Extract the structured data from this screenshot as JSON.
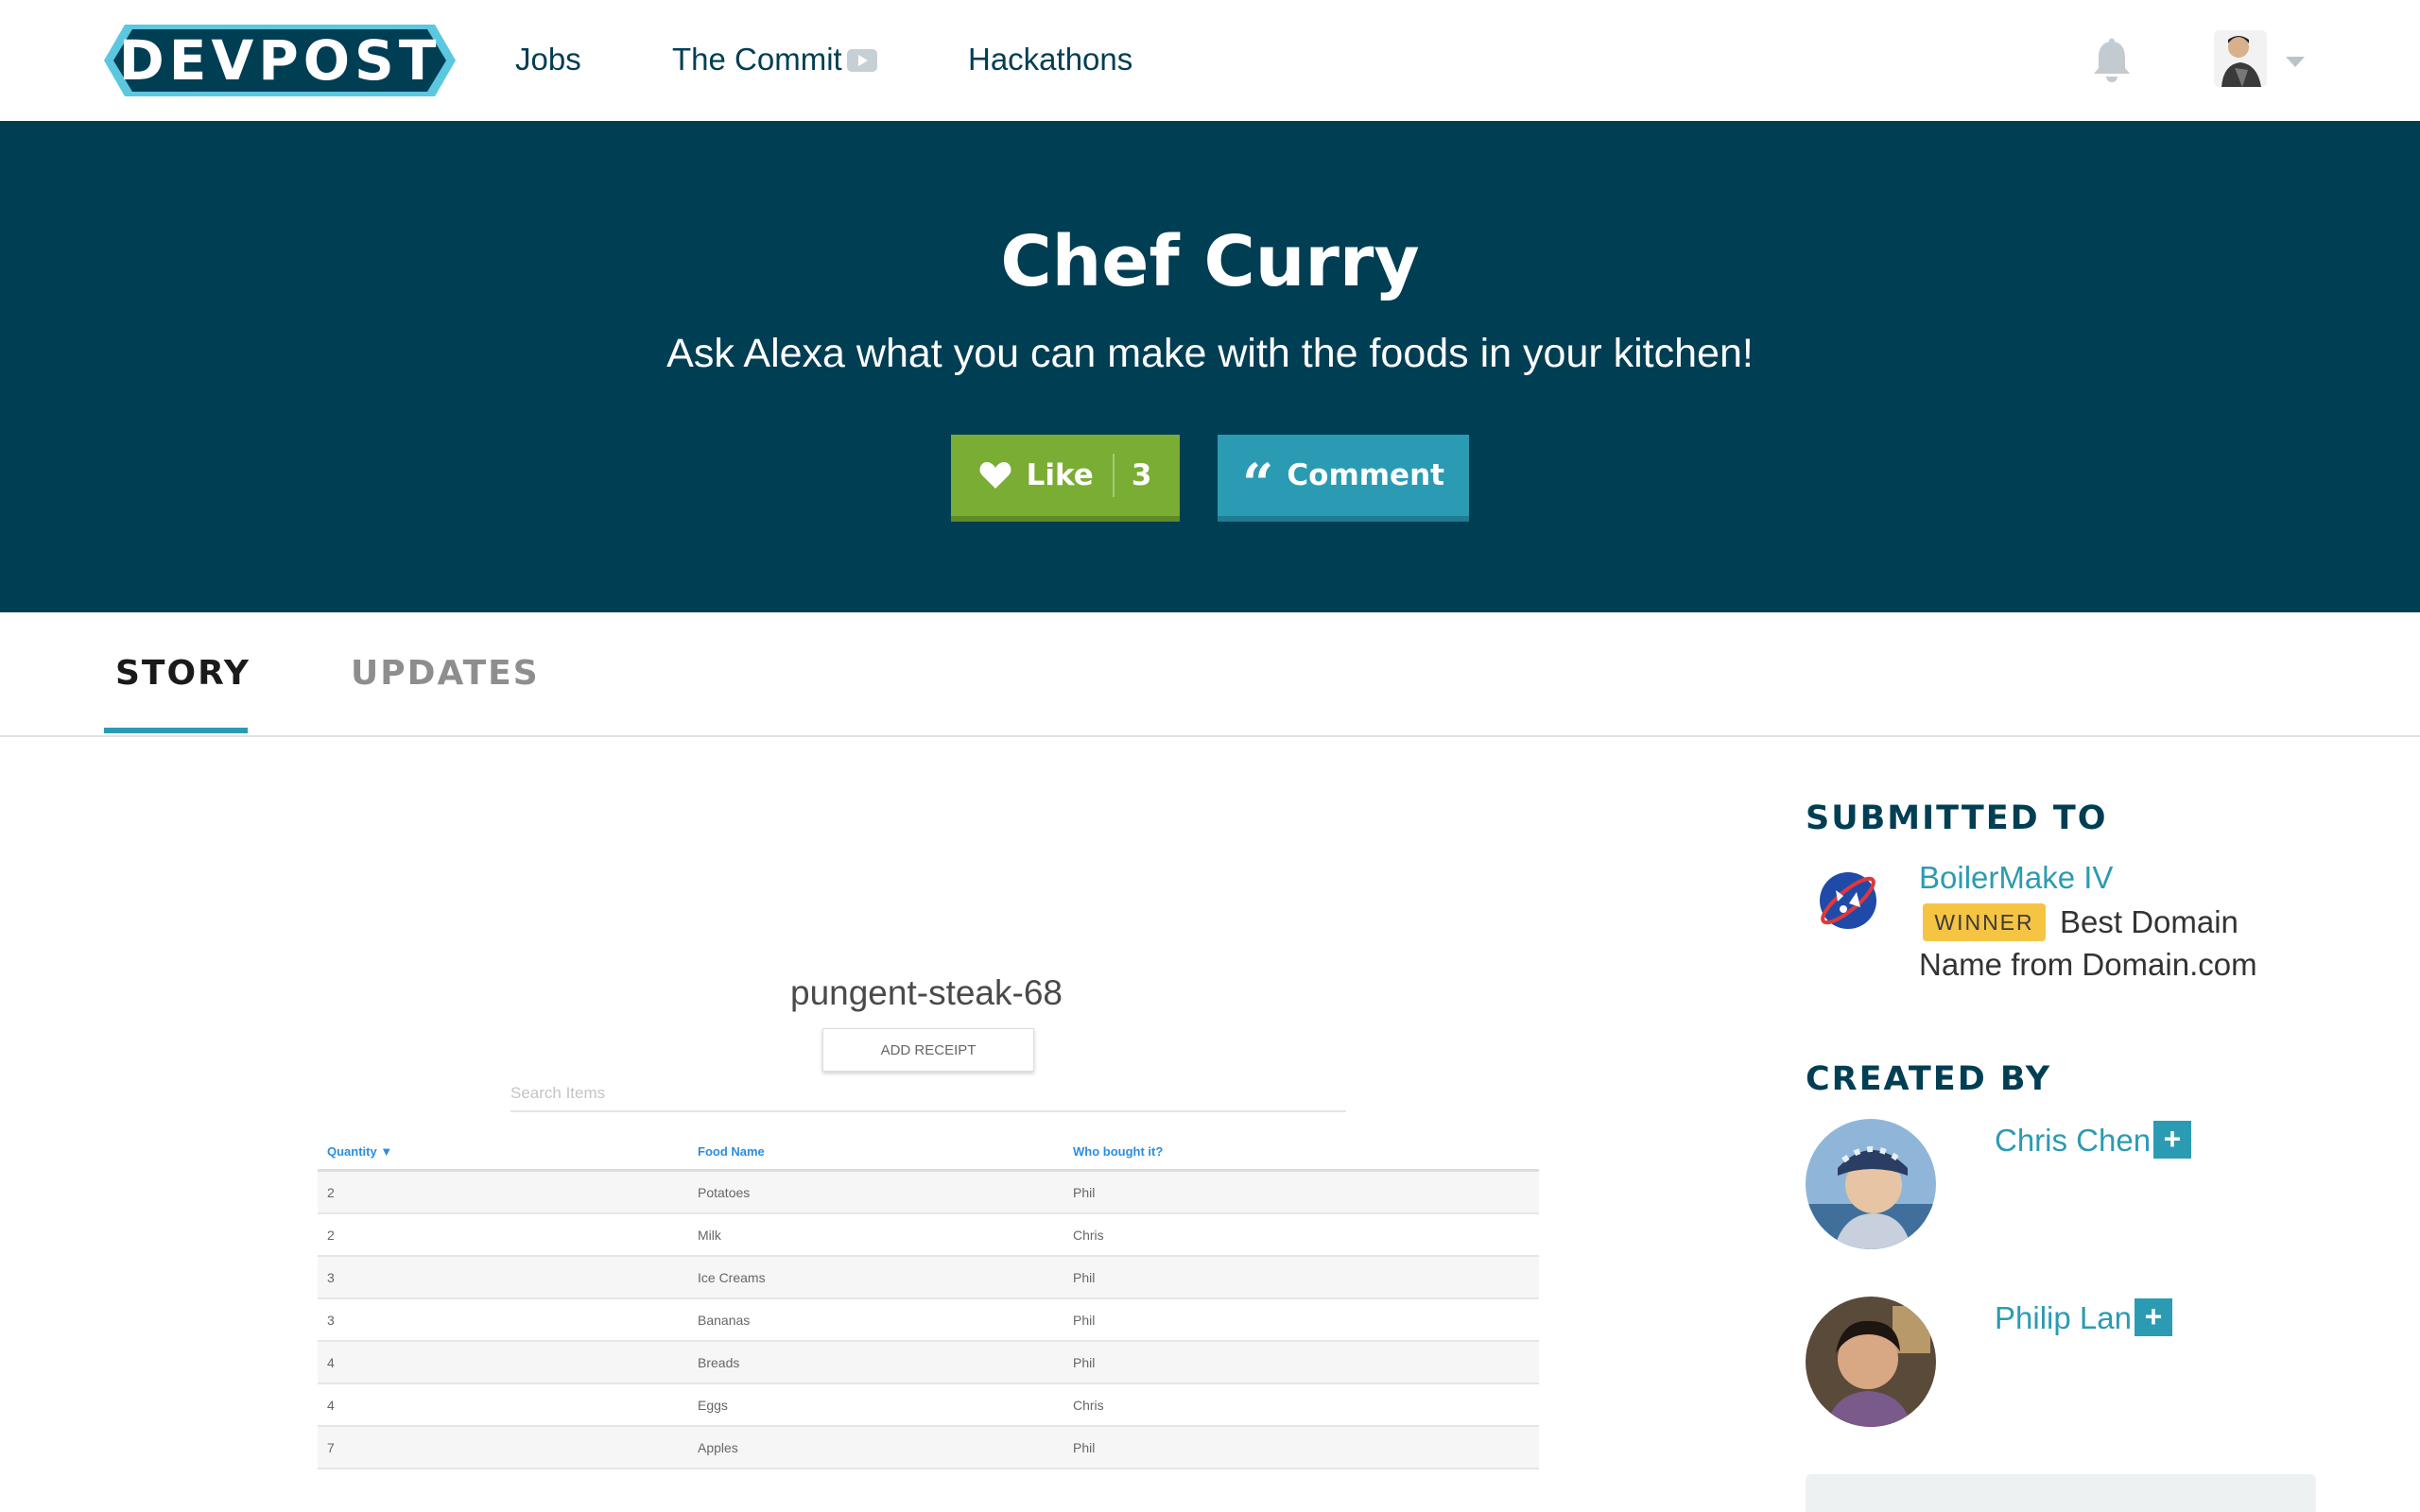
{
  "nav": {
    "logo_text": "DEVPOST",
    "links": [
      "Jobs",
      "The Commit",
      "Hackathons"
    ]
  },
  "hero": {
    "title": "Chef Curry",
    "tagline": "Ask Alexa what you can make with the foods in your kitchen!",
    "like_label": "Like",
    "like_count": "3",
    "comment_label": "Comment"
  },
  "tabs": [
    "STORY",
    "UPDATES"
  ],
  "gallery": {
    "title": "pungent-steak-68",
    "add_button": "ADD RECEIPT",
    "search_placeholder": "Search Items",
    "columns": [
      "Quantity ▼",
      "Food Name",
      "Who bought it?"
    ],
    "rows": [
      [
        "2",
        "Potatoes",
        "Phil"
      ],
      [
        "2",
        "Milk",
        "Chris"
      ],
      [
        "3",
        "Ice Creams",
        "Phil"
      ],
      [
        "3",
        "Bananas",
        "Phil"
      ],
      [
        "4",
        "Breads",
        "Phil"
      ],
      [
        "4",
        "Eggs",
        "Chris"
      ],
      [
        "7",
        "Apples",
        "Phil"
      ]
    ]
  },
  "sidebar": {
    "submitted_heading": "SUBMITTED TO",
    "hackathon": "BoilerMake IV",
    "badge": "WINNER",
    "prize": "Best Domain Name from Domain.com",
    "created_heading": "CREATED BY",
    "members": [
      "Chris Chen",
      "Philip Lan"
    ],
    "follow_symbol": "+"
  },
  "colors": {
    "brand_dark": "#003e54",
    "accent": "#2b9bb3",
    "like_green": "#7aad33",
    "winner_yellow": "#f6c443"
  }
}
